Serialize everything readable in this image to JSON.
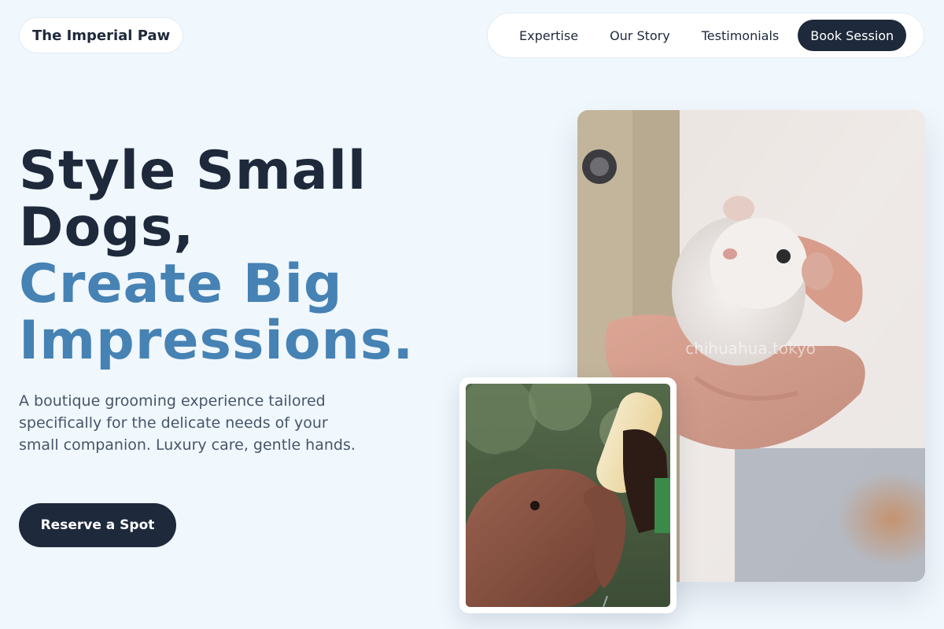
{
  "brand": {
    "name": "The Imperial Paw"
  },
  "nav": {
    "links": [
      "Expertise",
      "Our Story",
      "Testimonials"
    ],
    "cta": "Book Session"
  },
  "hero": {
    "title_line1": "Style Small",
    "title_line2": "Dogs,",
    "title_line3": "Create Big",
    "title_line4": "Impressions.",
    "description": "A boutique grooming experience tailored specifically for the delicate needs of your small companion. Luxury care, gentle hands.",
    "cta": "Reserve a Spot"
  },
  "images": {
    "main_watermark": "chihuahua.tokyo"
  },
  "colors": {
    "background": "#f0f7fd",
    "text_dark": "#1e293b",
    "accent": "#4682b4",
    "muted_text": "#475569",
    "button": "#1e293b"
  }
}
